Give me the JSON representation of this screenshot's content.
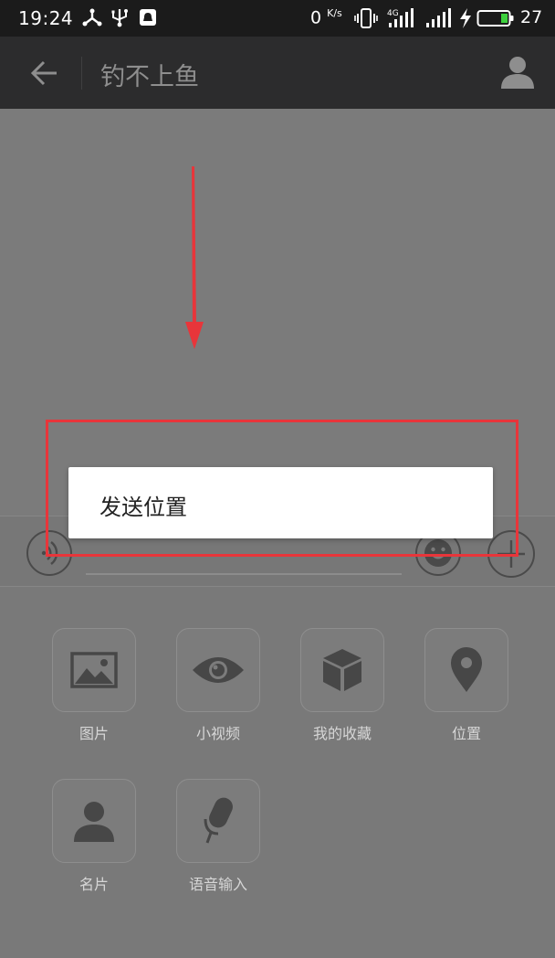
{
  "status_bar": {
    "time": "19:24",
    "speed_value": "0",
    "speed_unit": "K/s",
    "battery_level": "27",
    "network": "4G",
    "icons": [
      "share-icon",
      "usb-icon",
      "notification-icon",
      "vibrate-icon",
      "signal-4g-icon",
      "signal-icon",
      "charging-icon",
      "battery-icon"
    ]
  },
  "header": {
    "title": "钓不上鱼",
    "back_icon": "arrow-left-icon",
    "profile_icon": "person-icon"
  },
  "input_bar": {
    "voice_icon": "voice-icon",
    "emoji_icon": "emoji-icon",
    "plus_icon": "plus-icon"
  },
  "popup": {
    "items": [
      "发送位置"
    ]
  },
  "tools": [
    {
      "label": "图片",
      "icon": "image-icon"
    },
    {
      "label": "小视频",
      "icon": "eye-icon"
    },
    {
      "label": "我的收藏",
      "icon": "cube-icon"
    },
    {
      "label": "位置",
      "icon": "location-pin-icon"
    },
    {
      "label": "名片",
      "icon": "person-icon"
    },
    {
      "label": "语音输入",
      "icon": "microphone-icon"
    }
  ],
  "colors": {
    "status_bar_bg": "#1b1b1b",
    "title_bar_bg": "#2c2c2d",
    "dim_overlay": "#7a7a7a",
    "annotation_red": "#e8353a",
    "battery_green": "#3ed13e"
  }
}
